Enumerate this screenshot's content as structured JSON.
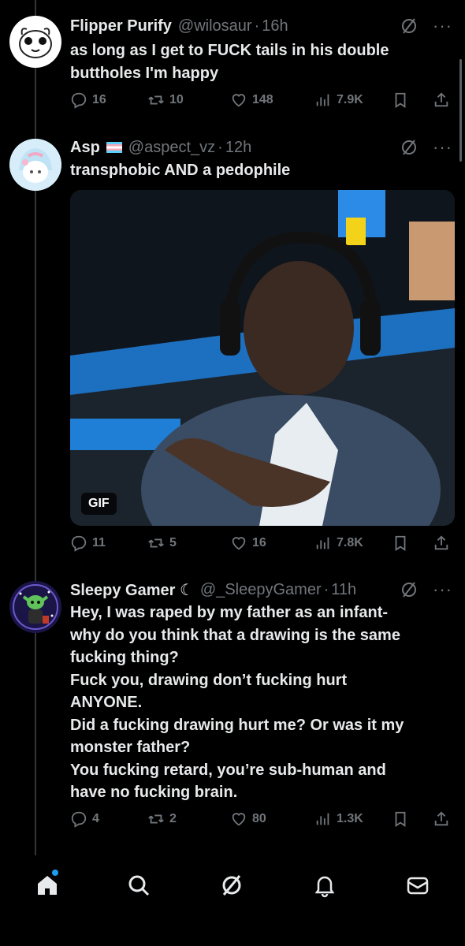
{
  "tweets": [
    {
      "name": "Flipper Purify",
      "handle": "@wilosaur",
      "time": "16h",
      "lines": [
        "as long as I get to FUCK tails in his double",
        "buttholes I'm happy"
      ],
      "replies": "16",
      "reposts": "10",
      "likes": "148",
      "views": "7.9K"
    },
    {
      "name": "Asp",
      "handle": "@aspect_vz",
      "time": "12h",
      "lines": [
        "transphobic AND a pedophile"
      ],
      "media_badge": "GIF",
      "replies": "11",
      "reposts": "5",
      "likes": "16",
      "views": "7.8K"
    },
    {
      "name": "Sleepy Gamer ☾",
      "handle": "@_SleepyGamer",
      "time": "11h",
      "lines": [
        "Hey, I was raped by my father as an infant-",
        "why do you think that a drawing is the same",
        "fucking thing?",
        "Fuck you, drawing don’t fucking hurt",
        "ANYONE.",
        "Did a fucking drawing hurt me? Or was it my",
        "monster father?",
        "You fucking retard, you’re sub-human and",
        "have no fucking brain."
      ],
      "replies": "4",
      "reposts": "2",
      "likes": "80",
      "views": "1.3K"
    }
  ],
  "separator": "·",
  "more": "···",
  "icons": {
    "reply": "reply-icon",
    "repost": "repost-icon",
    "like": "like-icon",
    "views": "views-icon",
    "bookmark": "bookmark-icon",
    "share": "share-icon",
    "grok": "grok-icon"
  },
  "nav": [
    "home-icon",
    "search-icon",
    "grok-icon",
    "notifications-icon",
    "messages-icon"
  ],
  "colors": {
    "background": "#000000",
    "text": "#e7e9ea",
    "muted": "#71767b",
    "accent": "#1d9bf0"
  }
}
